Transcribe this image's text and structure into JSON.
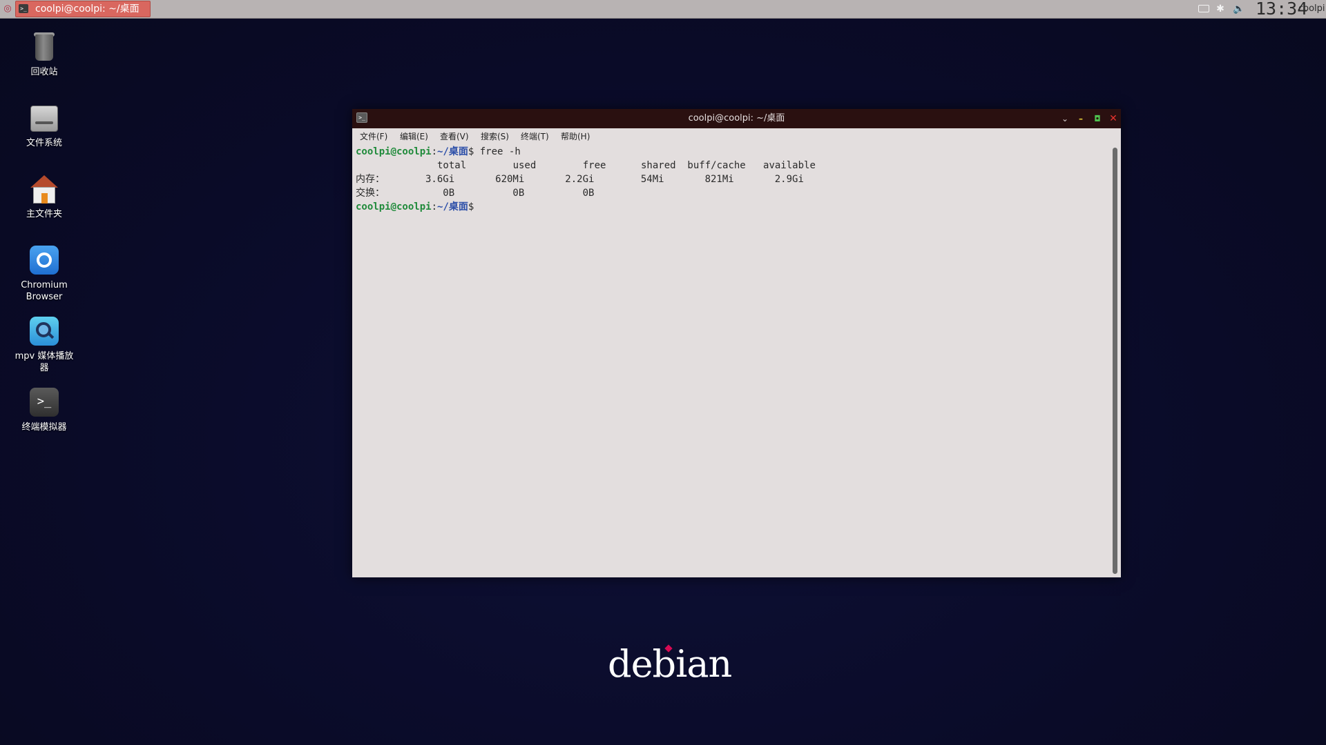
{
  "panel": {
    "taskbar_title": "coolpi@coolpi: ~/桌面",
    "clock": "13:34",
    "user": "coolpi"
  },
  "desktop_icons": [
    {
      "label": "回收站",
      "icon": "trash-icon"
    },
    {
      "label": "文件系统",
      "icon": "filesystem-icon"
    },
    {
      "label": "主文件夹",
      "icon": "home-folder-icon"
    },
    {
      "label": "Chromium Browser",
      "icon": "chromium-icon"
    },
    {
      "label": "mpv 媒体播放器",
      "icon": "mpv-icon"
    },
    {
      "label": "终端模拟器",
      "icon": "terminal-icon"
    }
  ],
  "window": {
    "title": "coolpi@coolpi: ~/桌面",
    "menu": [
      "文件(F)",
      "编辑(E)",
      "查看(V)",
      "搜索(S)",
      "终端(T)",
      "帮助(H)"
    ],
    "prompt_user": "coolpi@coolpi",
    "prompt_path": "~/桌面",
    "prompt_symbol": "$",
    "command": " free -h",
    "output": [
      "              total        used        free      shared  buff/cache   available",
      "内存：       3.6Gi       620Mi       2.2Gi        54Mi       821Mi       2.9Gi",
      "交换：          0B          0B          0B"
    ]
  },
  "branding": {
    "logo_text": "debian"
  },
  "colors": {
    "prompt_user": "#1f8a3a",
    "prompt_path": "#2b4ea8",
    "taskbar_active": "#d9675f",
    "titlebar": "#2a1010",
    "desktop_bg": "#0b0c2b"
  }
}
